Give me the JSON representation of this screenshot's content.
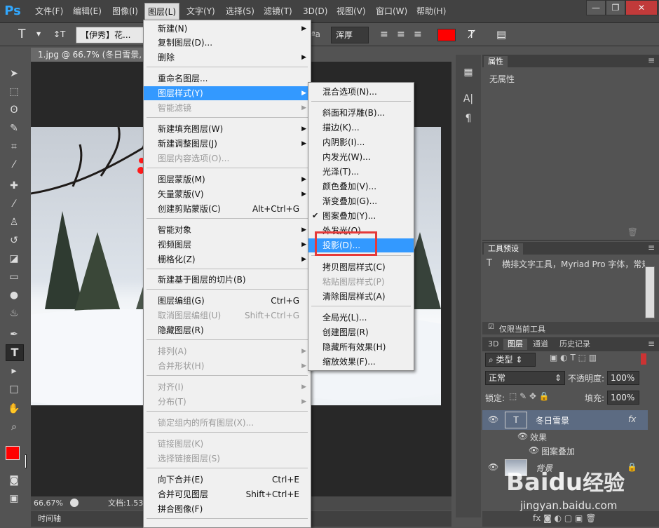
{
  "app": {
    "logo": "Ps"
  },
  "menubar": {
    "items": [
      "文件(F)",
      "编辑(E)",
      "图像(I)",
      "图层(L)",
      "文字(Y)",
      "选择(S)",
      "滤镜(T)",
      "3D(D)",
      "视图(V)",
      "窗口(W)",
      "帮助(H)"
    ],
    "active": "图层(L)"
  },
  "window_controls": {
    "minimize": "—",
    "restore": "❐",
    "close": "✕"
  },
  "options": {
    "tool_icon": "T",
    "orient_icon": "↕T",
    "font_name": "【伊秀】花...",
    "aa_label": "ªa",
    "aa_mode": "浑厚",
    "text_color": "#ff0000"
  },
  "document": {
    "tab_title": "1.jpg @ 66.7% (冬日雪景, R",
    "zoom": "66.67%",
    "doc_info": "文档:1.53",
    "timeline_label": "时间轴"
  },
  "panels": {
    "properties": {
      "tab": "属性",
      "empty": "无属性"
    },
    "tool_presets": {
      "tab": "工具预设",
      "item": "横排文字工具，Myriad Pro 字体，常规",
      "checkbox_label": "仅限当前工具"
    },
    "layers": {
      "tabs": [
        "3D",
        "图层",
        "通道",
        "历史记录"
      ],
      "filter_kind": "类型",
      "blend_mode": "正常",
      "opacity_label": "不透明度:",
      "opacity_value": "100%",
      "lock_label": "锁定:",
      "fill_label": "填充:",
      "fill_value": "100%",
      "rows": [
        {
          "name": "冬日雪景",
          "thumb": "T",
          "fx": "fx"
        },
        {
          "name": "效果"
        },
        {
          "name": "图案叠加"
        },
        {
          "name": "背景"
        }
      ]
    }
  },
  "layer_menu": {
    "items": [
      {
        "label": "新建(N)",
        "arrow": true
      },
      {
        "label": "复制图层(D)..."
      },
      {
        "label": "删除",
        "arrow": true
      },
      {
        "label": "重命名图层..."
      },
      {
        "label": "图层样式(Y)",
        "arrow": true,
        "highlight": true
      },
      {
        "label": "智能滤镜",
        "disabled": true,
        "arrow": true
      },
      {
        "label": "新建填充图层(W)",
        "arrow": true
      },
      {
        "label": "新建调整图层(J)",
        "arrow": true
      },
      {
        "label": "图层内容选项(O)...",
        "disabled": true
      },
      {
        "label": "图层蒙版(M)",
        "arrow": true
      },
      {
        "label": "矢量蒙版(V)",
        "arrow": true
      },
      {
        "label": "创建剪贴蒙版(C)",
        "shortcut": "Alt+Ctrl+G"
      },
      {
        "label": "智能对象",
        "arrow": true
      },
      {
        "label": "视频图层",
        "arrow": true
      },
      {
        "label": "栅格化(Z)",
        "arrow": true
      },
      {
        "label": "新建基于图层的切片(B)"
      },
      {
        "label": "图层编组(G)",
        "shortcut": "Ctrl+G"
      },
      {
        "label": "取消图层编组(U)",
        "shortcut": "Shift+Ctrl+G",
        "disabled": true
      },
      {
        "label": "隐藏图层(R)"
      },
      {
        "label": "排列(A)",
        "disabled": true,
        "arrow": true
      },
      {
        "label": "合并形状(H)",
        "disabled": true,
        "arrow": true
      },
      {
        "label": "对齐(I)",
        "disabled": true,
        "arrow": true
      },
      {
        "label": "分布(T)",
        "disabled": true,
        "arrow": true
      },
      {
        "label": "锁定组内的所有图层(X)...",
        "disabled": true
      },
      {
        "label": "链接图层(K)",
        "disabled": true
      },
      {
        "label": "选择链接图层(S)",
        "disabled": true
      },
      {
        "label": "向下合并(E)",
        "shortcut": "Ctrl+E"
      },
      {
        "label": "合并可见图层",
        "shortcut": "Shift+Ctrl+E"
      },
      {
        "label": "拼合图像(F)"
      }
    ]
  },
  "style_submenu": {
    "items": [
      {
        "label": "混合选项(N)..."
      },
      {
        "label": "斜面和浮雕(B)..."
      },
      {
        "label": "描边(K)..."
      },
      {
        "label": "内阴影(I)..."
      },
      {
        "label": "内发光(W)..."
      },
      {
        "label": "光泽(T)..."
      },
      {
        "label": "颜色叠加(V)..."
      },
      {
        "label": "渐变叠加(G)..."
      },
      {
        "label": "图案叠加(Y)...",
        "checked": true
      },
      {
        "label": "外发光(O)..."
      },
      {
        "label": "投影(D)...",
        "highlight": true
      },
      {
        "label": "拷贝图层样式(C)"
      },
      {
        "label": "粘贴图层样式(P)",
        "disabled": true
      },
      {
        "label": "清除图层样式(A)"
      },
      {
        "label": "全局光(L)..."
      },
      {
        "label": "创建图层(R)"
      },
      {
        "label": "隐藏所有效果(H)"
      },
      {
        "label": "缩放效果(F)..."
      }
    ]
  },
  "watermark": {
    "brand": "Bai",
    "paw": "du",
    "suffix": "经验",
    "url": "jingyan.baidu.com"
  }
}
